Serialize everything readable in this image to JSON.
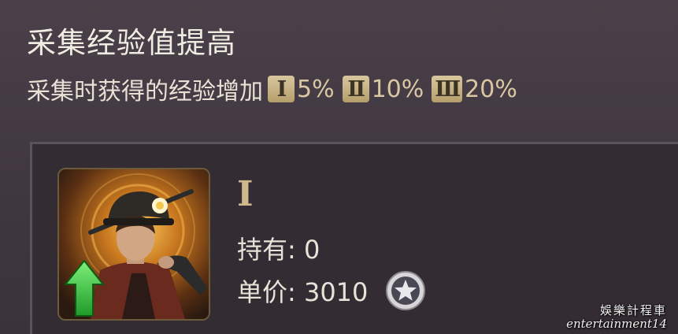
{
  "skill": {
    "title": "采集经验值提高",
    "description": "采集时获得的经验增加",
    "tiers": [
      {
        "numeral": "Ⅰ",
        "value": "5%"
      },
      {
        "numeral": "Ⅱ",
        "value": "10%"
      },
      {
        "numeral": "Ⅲ",
        "value": "20%"
      }
    ]
  },
  "card": {
    "rank": "Ⅰ",
    "owned_label": "持有: 0",
    "price_label": "单价: 3010",
    "portrait_icon": "miner-portrait-icon",
    "upgrade_icon": "green-up-arrow-icon",
    "currency_icon": "star-coin-icon"
  },
  "watermark": {
    "line1": "娛樂計程車",
    "line2": "entertainment14"
  }
}
